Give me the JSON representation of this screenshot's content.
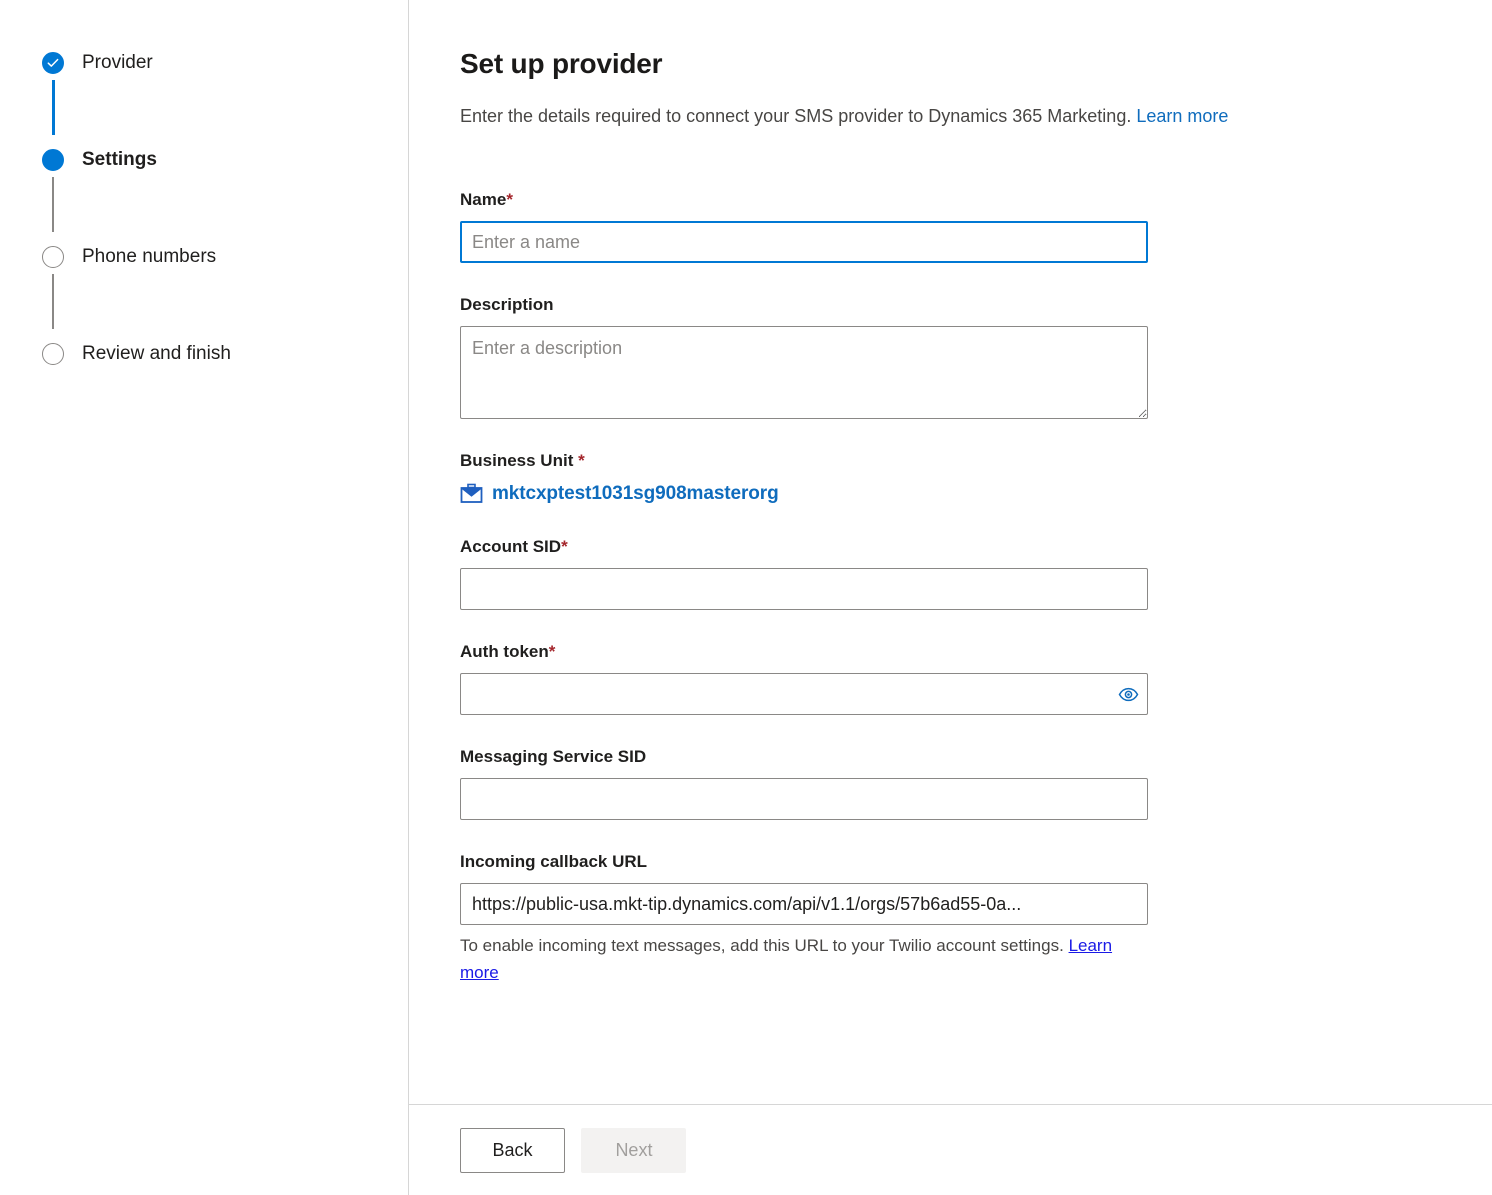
{
  "stepper": {
    "steps": [
      {
        "label": "Provider",
        "state": "completed",
        "icon": "check-icon"
      },
      {
        "label": "Settings",
        "state": "current",
        "icon": "filled-circle-icon"
      },
      {
        "label": "Phone numbers",
        "state": "todo",
        "icon": "empty-circle-icon"
      },
      {
        "label": "Review and finish",
        "state": "todo",
        "icon": "empty-circle-icon"
      }
    ]
  },
  "header": {
    "title": "Set up provider",
    "subtitle_text": "Enter the details required to connect your SMS provider to Dynamics 365 Marketing.",
    "subtitle_link": "Learn more"
  },
  "form": {
    "name": {
      "label": "Name",
      "required_marker": "*",
      "value": "",
      "placeholder": "Enter a name",
      "focused": true
    },
    "description": {
      "label": "Description",
      "value": "",
      "placeholder": "Enter a description"
    },
    "business_unit": {
      "label": "Business Unit",
      "required_marker": "*",
      "icon": "briefcase-icon",
      "value": "mktcxptest1031sg908masterorg"
    },
    "account_sid": {
      "label": "Account SID",
      "required_marker": "*",
      "value": "",
      "placeholder": ""
    },
    "auth_token": {
      "label": "Auth token",
      "required_marker": "*",
      "value": "",
      "placeholder": "",
      "reveal_icon": "eye-icon"
    },
    "messaging_service_sid": {
      "label": "Messaging Service SID",
      "value": "",
      "placeholder": ""
    },
    "incoming_callback_url": {
      "label": "Incoming callback URL",
      "value": "https://public-usa.mkt-tip.dynamics.com/api/v1.1/orgs/57b6ad55-0a...",
      "help_text": "To enable incoming text messages, add this URL to your Twilio account settings.",
      "help_link": "Learn more"
    }
  },
  "footer": {
    "back_label": "Back",
    "next_label": "Next",
    "next_disabled": true
  },
  "colors": {
    "accent": "#0078d4",
    "link": "#0f6cbd",
    "link_visited": "#1a1ae6",
    "required": "#a4262c",
    "border": "#8a8886",
    "divider": "#d6d6d6",
    "disabled_bg": "#f3f2f1",
    "disabled_text": "#a19f9d",
    "text": "#201f1e",
    "secondary_text": "#484644",
    "placeholder": "#8a8886"
  }
}
